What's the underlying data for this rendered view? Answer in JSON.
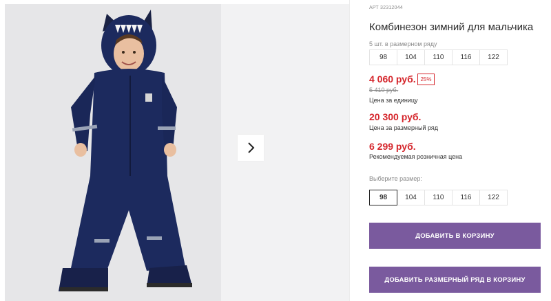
{
  "product": {
    "article": "АРТ 32312044",
    "title": "Комбинезон зимний для мальчика",
    "pack_label": "5 шт. в размерном ряду",
    "pack_sizes": [
      "98",
      "104",
      "110",
      "116",
      "122"
    ],
    "price_unit": "4 060 руб.",
    "discount": "25%",
    "old_price": "5 410 руб.",
    "price_unit_caption": "Цена за единицу",
    "price_pack": "20 300 руб.",
    "price_pack_caption": "Цена за размерный ряд",
    "price_retail": "6 299 руб.",
    "price_retail_caption": "Рекомендуемая розничная цена",
    "choose_size_label": "Выберите размер:",
    "sizes": [
      "98",
      "104",
      "110",
      "116",
      "122"
    ],
    "selected_size": "98",
    "add_to_cart": "ДОБАВИТЬ В КОРЗИНУ",
    "add_pack_to_cart": "ДОБАВИТЬ РАЗМЕРНЫЙ РЯД В КОРЗИНУ"
  },
  "gallery": {
    "next_icon": "chevron-right-icon"
  },
  "colors": {
    "accent": "#7a5a9e",
    "price_red": "#d5252b",
    "suit_navy": "#1c2a5e"
  }
}
